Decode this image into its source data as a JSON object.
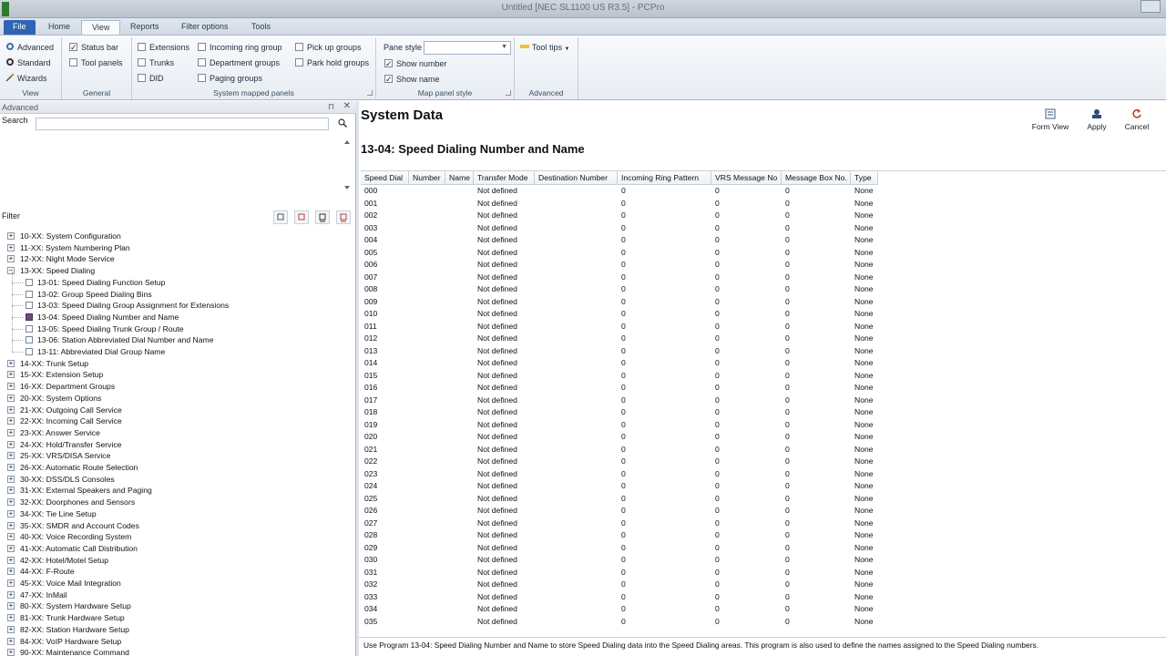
{
  "window": {
    "title": "Untitled [NEC SL1100 US R3.5] - PCPro"
  },
  "tabs": {
    "file": "File",
    "home": "Home",
    "view": "View",
    "reports": "Reports",
    "filter_options": "Filter options",
    "tools": "Tools"
  },
  "ribbon": {
    "view_group": {
      "advanced": "Advanced",
      "standard": "Standard",
      "wizards": "Wizards",
      "label": "View"
    },
    "general": {
      "status_bar": "Status bar",
      "tool_panels": "Tool panels",
      "label": "General"
    },
    "system_panels": {
      "extensions": "Extensions",
      "trunks": "Trunks",
      "did": "DID",
      "incoming_ring_group": "Incoming ring group",
      "department_groups": "Department groups",
      "paging_groups": "Paging groups",
      "pick_up_groups": "Pick up groups",
      "park_hold_groups": "Park hold groups",
      "label": "System mapped panels"
    },
    "map_panel": {
      "pane_style": "Pane style",
      "show_number": "Show number",
      "show_name": "Show name",
      "label": "Map panel style"
    },
    "advanced": {
      "tool_tips": "Tool tips",
      "label": "Advanced"
    }
  },
  "left": {
    "panel_title": "Advanced",
    "search_label": "Search",
    "filter_label": "Filter"
  },
  "tree": [
    {
      "label": "10-XX: System Configuration",
      "level": 0,
      "sign": "+"
    },
    {
      "label": "11-XX: System Numbering Plan",
      "level": 0,
      "sign": "+"
    },
    {
      "label": "12-XX: Night Mode Service",
      "level": 0,
      "sign": "+"
    },
    {
      "label": "13-XX: Speed Dialing",
      "level": 0,
      "sign": "−"
    },
    {
      "label": "13-01: Speed Dialing Function Setup",
      "level": 1
    },
    {
      "label": "13-02: Group Speed Dialing Bins",
      "level": 1
    },
    {
      "label": "13-03: Speed Dialing Group Assignment for Extensions",
      "level": 1
    },
    {
      "label": "13-04: Speed Dialing Number and Name",
      "level": 1,
      "selected": true
    },
    {
      "label": "13-05: Speed Dialing Trunk Group / Route",
      "level": 1
    },
    {
      "label": "13-06: Station Abbreviated Dial Number and Name",
      "level": 1
    },
    {
      "label": "13-11: Abbreviated Dial Group Name",
      "level": 1
    },
    {
      "label": "14-XX: Trunk Setup",
      "level": 0,
      "sign": "+"
    },
    {
      "label": "15-XX: Extension Setup",
      "level": 0,
      "sign": "+"
    },
    {
      "label": "16-XX: Department Groups",
      "level": 0,
      "sign": "+"
    },
    {
      "label": "20-XX: System Options",
      "level": 0,
      "sign": "+"
    },
    {
      "label": "21-XX: Outgoing Call Service",
      "level": 0,
      "sign": "+"
    },
    {
      "label": "22-XX: Incoming Call Service",
      "level": 0,
      "sign": "+"
    },
    {
      "label": "23-XX: Answer Service",
      "level": 0,
      "sign": "+"
    },
    {
      "label": "24-XX: Hold/Transfer Service",
      "level": 0,
      "sign": "+"
    },
    {
      "label": "25-XX: VRS/DISA Service",
      "level": 0,
      "sign": "+"
    },
    {
      "label": "26-XX: Automatic Route Selection",
      "level": 0,
      "sign": "+"
    },
    {
      "label": "30-XX: DSS/DLS Consoles",
      "level": 0,
      "sign": "+"
    },
    {
      "label": "31-XX: External Speakers and Paging",
      "level": 0,
      "sign": "+"
    },
    {
      "label": "32-XX: Doorphones and Sensors",
      "level": 0,
      "sign": "+"
    },
    {
      "label": "34-XX: Tie Line Setup",
      "level": 0,
      "sign": "+"
    },
    {
      "label": "35-XX: SMDR and Account Codes",
      "level": 0,
      "sign": "+"
    },
    {
      "label": "40-XX: Voice Recording System",
      "level": 0,
      "sign": "+"
    },
    {
      "label": "41-XX: Automatic Call Distribution",
      "level": 0,
      "sign": "+"
    },
    {
      "label": "42-XX: Hotel/Motel Setup",
      "level": 0,
      "sign": "+"
    },
    {
      "label": "44-XX: F-Route",
      "level": 0,
      "sign": "+"
    },
    {
      "label": "45-XX: Voice Mail Integration",
      "level": 0,
      "sign": "+"
    },
    {
      "label": "47-XX: InMail",
      "level": 0,
      "sign": "+"
    },
    {
      "label": "80-XX: System Hardware Setup",
      "level": 0,
      "sign": "+"
    },
    {
      "label": "81-XX: Trunk Hardware Setup",
      "level": 0,
      "sign": "+"
    },
    {
      "label": "82-XX: Station Hardware Setup",
      "level": 0,
      "sign": "+"
    },
    {
      "label": "84-XX: VoIP Hardware Setup",
      "level": 0,
      "sign": "+"
    },
    {
      "label": "90-XX: Maintenance Command",
      "level": 0,
      "sign": "+"
    }
  ],
  "main": {
    "title": "System Data",
    "program_title": "13-04: Speed Dialing Number and Name",
    "buttons": {
      "form_view": "Form View",
      "apply": "Apply",
      "cancel": "Cancel"
    },
    "columns": [
      "Speed Dial",
      "Number",
      "Name",
      "Transfer Mode",
      "Destination Number",
      "Incoming Ring Pattern",
      "VRS Message No",
      "Message Box No.",
      "Type"
    ],
    "row_defaults": {
      "transfer_mode": "Not defined",
      "incoming_ring_pattern": "0",
      "vrs_message_no": "0",
      "message_box_no": "0",
      "type": "None"
    },
    "speed_dials": [
      "000",
      "001",
      "002",
      "003",
      "004",
      "005",
      "006",
      "007",
      "008",
      "009",
      "010",
      "011",
      "012",
      "013",
      "014",
      "015",
      "016",
      "017",
      "018",
      "019",
      "020",
      "021",
      "022",
      "023",
      "024",
      "025",
      "026",
      "027",
      "028",
      "029",
      "030",
      "031",
      "032",
      "033",
      "034",
      "035"
    ],
    "footer": "Use Program 13-04: Speed Dialing Number and Name to store Speed Dialing data into the Speed Dialing areas. This program is also used to define the names assigned to the Speed Dialing numbers."
  }
}
